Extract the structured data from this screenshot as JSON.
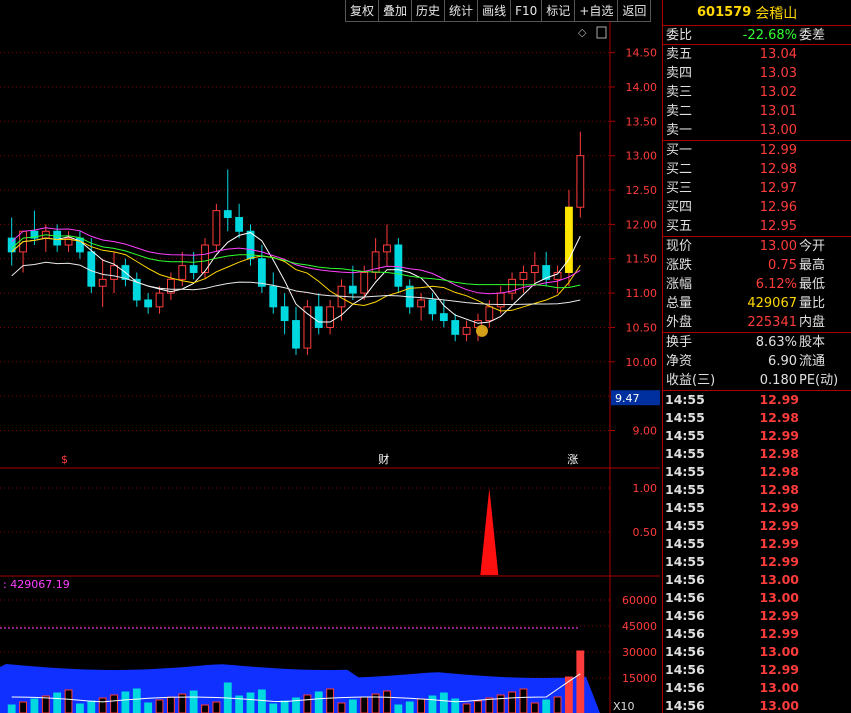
{
  "toolbar": {
    "buttons": [
      "复权",
      "叠加",
      "历史",
      "统计",
      "画线",
      "F10",
      "标记",
      "+自选",
      "返回"
    ]
  },
  "stock": {
    "code": "601579",
    "name": "会稽山"
  },
  "quote": {
    "wb": {
      "label": "委比",
      "value": "-22.68%",
      "label2": "委差"
    },
    "sells": [
      {
        "label": "卖五",
        "price": "13.04"
      },
      {
        "label": "卖四",
        "price": "13.03"
      },
      {
        "label": "卖三",
        "price": "13.02"
      },
      {
        "label": "卖二",
        "price": "13.01"
      },
      {
        "label": "卖一",
        "price": "13.00"
      }
    ],
    "buys": [
      {
        "label": "买一",
        "price": "12.99"
      },
      {
        "label": "买二",
        "price": "12.98"
      },
      {
        "label": "买三",
        "price": "12.97"
      },
      {
        "label": "买四",
        "price": "12.96"
      },
      {
        "label": "买五",
        "price": "12.95"
      }
    ],
    "stats": [
      {
        "label": "现价",
        "value": "13.00",
        "label2": "今开"
      },
      {
        "label": "涨跌",
        "value": "0.75",
        "label2": "最高"
      },
      {
        "label": "涨幅",
        "value": "6.12%",
        "label2": "最低"
      },
      {
        "label": "总量",
        "value": "429067",
        "label2": "量比"
      },
      {
        "label": "外盘",
        "value": "225341",
        "label2": "内盘"
      }
    ],
    "stats2": [
      {
        "label": "换手",
        "value": "8.63%",
        "label2": "股本"
      },
      {
        "label": "净资",
        "value": "6.90",
        "label2": "流通"
      },
      {
        "label": "收益(三)",
        "value": "0.180",
        "label2": "PE(动)"
      }
    ]
  },
  "ticks": [
    {
      "t": "14:55",
      "p": "12.99"
    },
    {
      "t": "14:55",
      "p": "12.98"
    },
    {
      "t": "14:55",
      "p": "12.99"
    },
    {
      "t": "14:55",
      "p": "12.98"
    },
    {
      "t": "14:55",
      "p": "12.98"
    },
    {
      "t": "14:55",
      "p": "12.98"
    },
    {
      "t": "14:55",
      "p": "12.99"
    },
    {
      "t": "14:55",
      "p": "12.99"
    },
    {
      "t": "14:55",
      "p": "12.99"
    },
    {
      "t": "14:55",
      "p": "12.99"
    },
    {
      "t": "14:56",
      "p": "13.00"
    },
    {
      "t": "14:56",
      "p": "13.00"
    },
    {
      "t": "14:56",
      "p": "12.99"
    },
    {
      "t": "14:56",
      "p": "12.99"
    },
    {
      "t": "14:56",
      "p": "13.00"
    },
    {
      "t": "14:56",
      "p": "12.99"
    },
    {
      "t": "14:56",
      "p": "13.00"
    },
    {
      "t": "14:56",
      "p": "13.00"
    }
  ],
  "chart_data": {
    "type": "candlestick",
    "price_ticks": [
      "14.50",
      "14.00",
      "13.50",
      "13.00",
      "12.50",
      "12.00",
      "11.50",
      "11.00",
      "10.50",
      "10.00",
      "9.50",
      "9.00"
    ],
    "price_ticks_values": [
      14.5,
      14,
      13.5,
      13,
      12.5,
      12,
      11.5,
      11,
      10.5,
      10,
      9.5,
      9
    ],
    "cursor_price": "9.47",
    "ylim": [
      8.6,
      14.8
    ],
    "candles": [
      [
        11.8,
        12.1,
        11.4,
        11.6
      ],
      [
        11.6,
        11.9,
        11.3,
        11.9
      ],
      [
        11.9,
        12.2,
        11.7,
        11.8
      ],
      [
        11.8,
        12.0,
        11.6,
        11.9
      ],
      [
        11.9,
        12.0,
        11.6,
        11.7
      ],
      [
        11.7,
        11.9,
        11.6,
        11.8
      ],
      [
        11.8,
        11.9,
        11.5,
        11.6
      ],
      [
        11.6,
        11.8,
        11.0,
        11.1
      ],
      [
        11.1,
        11.5,
        10.8,
        11.2
      ],
      [
        11.2,
        11.6,
        11.0,
        11.4
      ],
      [
        11.4,
        11.5,
        11.1,
        11.2
      ],
      [
        11.2,
        11.3,
        10.8,
        10.9
      ],
      [
        10.9,
        11.0,
        10.7,
        10.8
      ],
      [
        10.8,
        11.1,
        10.7,
        11.0
      ],
      [
        11.0,
        11.3,
        10.9,
        11.2
      ],
      [
        11.2,
        11.6,
        11.1,
        11.4
      ],
      [
        11.4,
        11.6,
        11.2,
        11.3
      ],
      [
        11.3,
        11.8,
        11.2,
        11.7
      ],
      [
        11.7,
        12.3,
        11.6,
        12.2
      ],
      [
        12.2,
        12.8,
        11.9,
        12.1
      ],
      [
        12.1,
        12.3,
        11.8,
        11.9
      ],
      [
        11.9,
        12.0,
        11.4,
        11.5
      ],
      [
        11.5,
        11.7,
        11.0,
        11.1
      ],
      [
        11.1,
        11.3,
        10.7,
        10.8
      ],
      [
        10.8,
        11.0,
        10.4,
        10.6
      ],
      [
        10.6,
        10.8,
        10.1,
        10.2
      ],
      [
        10.2,
        10.9,
        10.1,
        10.8
      ],
      [
        10.8,
        11.0,
        10.4,
        10.5
      ],
      [
        10.5,
        10.9,
        10.4,
        10.8
      ],
      [
        10.8,
        11.2,
        10.6,
        11.1
      ],
      [
        11.1,
        11.4,
        10.9,
        11.0
      ],
      [
        11.0,
        11.4,
        10.9,
        11.3
      ],
      [
        11.3,
        11.8,
        11.2,
        11.6
      ],
      [
        11.6,
        12.0,
        11.4,
        11.7
      ],
      [
        11.7,
        11.8,
        11.0,
        11.1
      ],
      [
        11.1,
        11.2,
        10.7,
        10.8
      ],
      [
        10.8,
        11.0,
        10.6,
        10.9
      ],
      [
        10.9,
        11.0,
        10.6,
        10.7
      ],
      [
        10.7,
        10.9,
        10.5,
        10.6
      ],
      [
        10.6,
        10.7,
        10.3,
        10.4
      ],
      [
        10.4,
        10.6,
        10.3,
        10.5
      ],
      [
        10.5,
        10.7,
        10.3,
        10.6
      ],
      [
        10.6,
        10.9,
        10.5,
        10.8
      ],
      [
        10.8,
        11.1,
        10.7,
        11.0
      ],
      [
        11.0,
        11.3,
        10.9,
        11.2
      ],
      [
        11.2,
        11.4,
        11.0,
        11.3
      ],
      [
        11.3,
        11.6,
        11.1,
        11.4
      ],
      [
        11.4,
        11.6,
        11.1,
        11.2
      ],
      [
        11.2,
        11.4,
        11.0,
        11.3
      ],
      [
        11.3,
        12.5,
        11.1,
        12.25
      ],
      [
        12.25,
        13.35,
        12.1,
        13.0
      ]
    ],
    "ma_lines": [
      {
        "name": "MA5",
        "color": "#ffffff"
      },
      {
        "name": "MA10",
        "color": "#ffd700"
      },
      {
        "name": "MA20",
        "color": "#ff40ff"
      },
      {
        "name": "MA30",
        "color": "#30ff30"
      },
      {
        "name": "MA60",
        "color": "#e8e8e8"
      }
    ],
    "markers": [
      {
        "label": "$",
        "color": "#ff3c3c"
      },
      {
        "label": "财",
        "color": "#ffffff"
      },
      {
        "label": "涨",
        "color": "#ffffff"
      }
    ],
    "indicator_ticks": [
      "1.00",
      "0.50"
    ],
    "volume_label": ": 429067.19",
    "volume_ticks": [
      "60000",
      "45000",
      "30000",
      "15000"
    ],
    "volume_unit": "X10"
  }
}
